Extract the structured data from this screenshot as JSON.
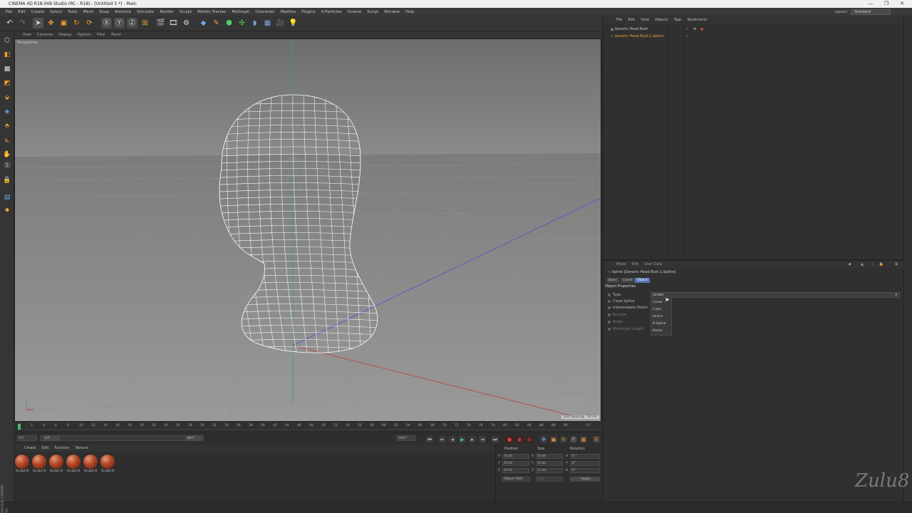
{
  "window": {
    "title": "CINEMA 4D R18.048 Studio (RC - R18) - [Untitled 5 *] - Main",
    "minimize": "—",
    "restore": "❐",
    "close": "✕"
  },
  "menu": [
    "File",
    "Edit",
    "Create",
    "Select",
    "Tools",
    "Mesh",
    "Snap",
    "Animate",
    "Simulate",
    "Render",
    "Sculpt",
    "Motion Tracker",
    "MoGraph",
    "Character",
    "Pipeline",
    "Plugins",
    "X-Particles",
    "Octane",
    "Script",
    "Window",
    "Help"
  ],
  "layout": {
    "label": "Layout:",
    "value": "Standard"
  },
  "viewport_menu": [
    "View",
    "Cameras",
    "Display",
    "Options",
    "Filter",
    "Panel"
  ],
  "viewport": {
    "label": "Perspective",
    "grid_spacing": "Grid Spacing : 10 cm"
  },
  "ruler": [
    "0",
    "2",
    "4",
    "6",
    "8",
    "10",
    "12",
    "14",
    "16",
    "18",
    "20",
    "22",
    "24",
    "26",
    "28",
    "30",
    "32",
    "34",
    "36",
    "38",
    "40",
    "42",
    "44",
    "46",
    "48",
    "50",
    "52",
    "54",
    "56",
    "58",
    "60",
    "62",
    "64",
    "66",
    "68",
    "70",
    "72",
    "74",
    "76",
    "78",
    "80",
    "82",
    "84",
    "86",
    "88",
    "90"
  ],
  "ruler_end": "0 F",
  "playback": {
    "start": "0 F",
    "start2": "0 F",
    "end": "90 F",
    "end2": "200 F"
  },
  "material_menu": [
    "Create",
    "Edit",
    "Function",
    "Texture"
  ],
  "materials": [
    "Sculpt B",
    "Sculpt B",
    "Sculpt B",
    "Sculpt B",
    "Sculpt B",
    "Sculpt B"
  ],
  "coords": {
    "headers": [
      "Position",
      "Size",
      "Rotation"
    ],
    "rows": [
      {
        "axis": "X",
        "pos": "0 cm",
        "size_axis": "X",
        "size": "0 cm",
        "rot_axis": "H",
        "rot": "0 °"
      },
      {
        "axis": "Y",
        "pos": "0 cm",
        "size_axis": "Y",
        "size": "0 cm",
        "rot_axis": "P",
        "rot": "0 °"
      },
      {
        "axis": "Z",
        "pos": "0 cm",
        "size_axis": "Z",
        "size": "0 cm",
        "rot_axis": "B",
        "rot": "0 °"
      }
    ],
    "mode": "Object (Rel)",
    "size_mode": "Size",
    "apply": "Apply"
  },
  "object_menu": [
    "File",
    "Edit",
    "View",
    "Objects",
    "Tags",
    "Bookmarks"
  ],
  "objects": [
    {
      "name": "Generic Head Bust",
      "color": "#c8c8c8"
    },
    {
      "name": "Generic Head Bust.1.Spline",
      "color": "#e8a33a"
    }
  ],
  "attr_menu": [
    "Mode",
    "Edit",
    "User Data"
  ],
  "attr_title": "Spline [Generic Head Bust.1.Spline]",
  "attr_tabs": [
    "Basic",
    "Coord.",
    "Object"
  ],
  "section": "Object Properties",
  "props": [
    "Type",
    "Close Spline",
    "Intermediate Points",
    "Number",
    "Angle",
    "Maximum Length"
  ],
  "type_value": "Linear",
  "dropdown": [
    "Linear",
    "Cubic",
    "Akima",
    "B-Spline",
    "Bezier"
  ],
  "maxon": "MAXON CINEMA 4D",
  "signature": "Zulu8"
}
